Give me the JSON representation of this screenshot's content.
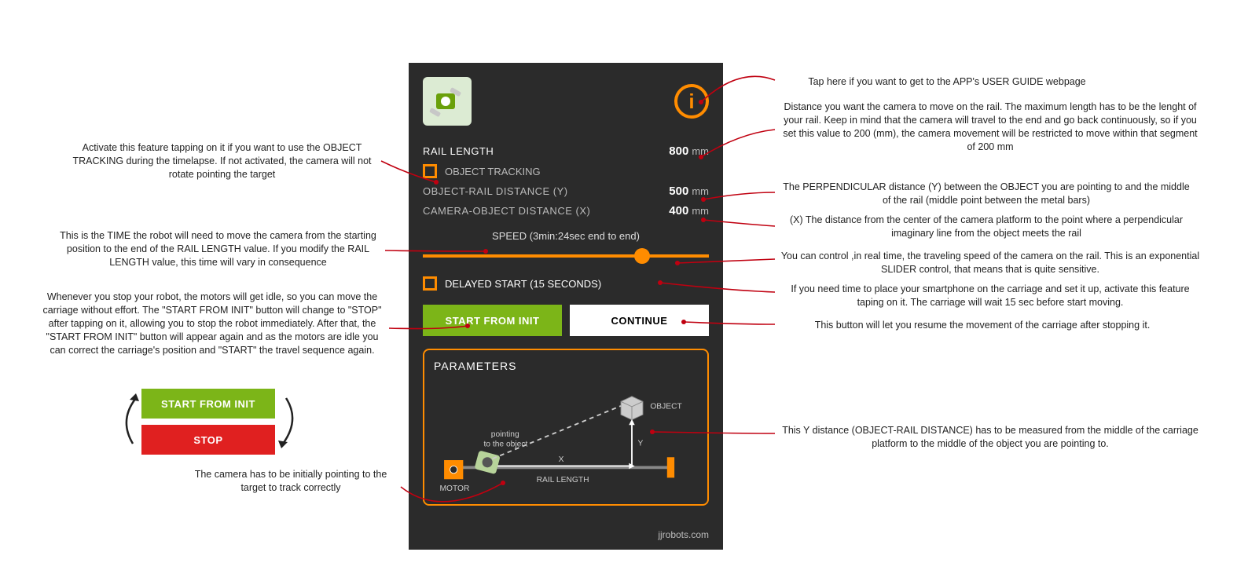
{
  "app": {
    "rail_length_label": "RAIL LENGTH",
    "rail_length_value": "800",
    "object_tracking_label": "OBJECT TRACKING",
    "object_rail_label": "OBJECT-RAIL DISTANCE (Y)",
    "object_rail_value": "500",
    "camera_object_label": "CAMERA-OBJECT DISTANCE (X)",
    "camera_object_value": "400",
    "unit": "mm",
    "speed_label": "SPEED (3min:24sec end to end)",
    "delayed_start_label": "DELAYED START (15 SECONDS)",
    "start_btn": "START FROM INIT",
    "continue_btn": "CONTINUE",
    "parameters_title": "PARAMETERS",
    "footer": "jjrobots.com",
    "diagram": {
      "object": "OBJECT",
      "motor": "MOTOR",
      "rail_length": "RAIL LENGTH",
      "pointing": "pointing\nto the object",
      "x": "X",
      "y": "Y"
    }
  },
  "annotations": {
    "left_tracking": "Activate this feature tapping on it if you want to use the OBJECT TRACKING during the timelapse. If not activated, the camera will not rotate pointing the target",
    "left_speed": "This is the TIME the robot will need to move the camera from the starting position to the end of the RAIL LENGTH value. If you modify the RAIL LENGTH value, this time will vary in consequence",
    "left_start": "Whenever you stop your robot, the motors will get idle, so you can move the carriage without effort. The \"START FROM INIT\" button will change to \"STOP\" after tapping on it, allowing you to stop the robot immediately. After that, the \"START FROM INIT\" button will appear again and as the motors are idle you can correct the carriage's position and \"START\" the travel sequence again.",
    "left_camera_pointing": "The camera has to be initially pointing to the target to track correctly",
    "right_info": "Tap here if you want to get to the APP's USER GUIDE webpage",
    "right_rail": "Distance you want the camera to move on the rail. The maximum length has to be the lenght of your rail. Keep in mind that the camera will travel to the end and go back continuously, so if you set this value to 200 (mm), the camera movement will be restricted to move within that segment of 200 mm",
    "right_obj_rail": "The PERPENDICULAR distance (Y) between the OBJECT you are pointing to and the middle of the rail (middle point between the metal bars)",
    "right_cam_obj": "(X) The distance from the center of the camera platform to the point where a perpendicular imaginary line from the object meets the rail",
    "right_slider": "You can control ,in real time, the traveling speed of the camera on the rail. This is an exponential SLIDER control, that means that is quite sensitive.",
    "right_delayed": "If you need time to place your smartphone on the carriage and set it up, activate this feature taping on it. The carriage will wait 15 sec before start moving.",
    "right_continue": "This button will let you resume the movement of the carriage after stopping it.",
    "right_y": "This Y distance (OBJECT-RAIL DISTANCE) has to be measured from the middle of the carriage platform to the middle of the object you are pointing to."
  },
  "demo_buttons": {
    "start": "START FROM INIT",
    "stop": "STOP"
  }
}
